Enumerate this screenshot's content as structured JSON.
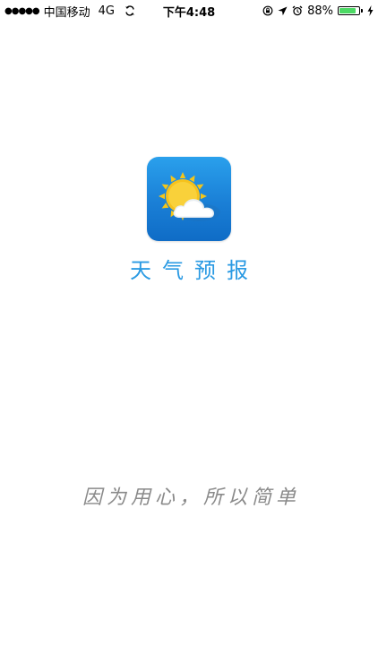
{
  "status_bar": {
    "signal_dots": "●●●●●",
    "carrier": "中国移动",
    "network": "4G",
    "time": "下午4:48",
    "battery_percent_label": "88%",
    "battery_level": 0.88,
    "icons": [
      "sync-icon",
      "orientation-lock-icon",
      "location-arrow-icon",
      "alarm-icon",
      "charging-bolt-icon"
    ],
    "battery_color": "#4cd964"
  },
  "splash": {
    "app_name": "天气预报",
    "slogan": "因为用心，所以简单",
    "title_color": "#2a9ae3",
    "slogan_color": "#8a8a8a",
    "icon": "weather-sun-cloud-icon"
  }
}
